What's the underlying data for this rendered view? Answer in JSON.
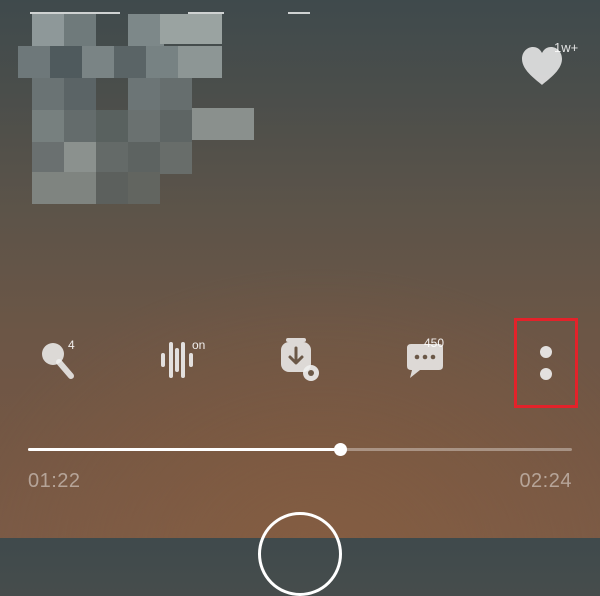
{
  "like": {
    "icon": "heart-icon",
    "count": "1w+"
  },
  "controls": {
    "karaoke": {
      "icon": "microphone-icon",
      "badge": "4"
    },
    "sound_effect": {
      "icon": "sound-effect-icon",
      "badge": "on"
    },
    "download": {
      "icon": "download-icon",
      "badge": ""
    },
    "comments": {
      "icon": "comment-icon",
      "badge": "450"
    },
    "more": {
      "icon": "more-vertical-icon"
    }
  },
  "player": {
    "elapsed": "01:22",
    "total": "02:24",
    "progress": 0.574
  },
  "colors": {
    "highlight": "#e3222a",
    "progress_fill": "#ffffff"
  }
}
